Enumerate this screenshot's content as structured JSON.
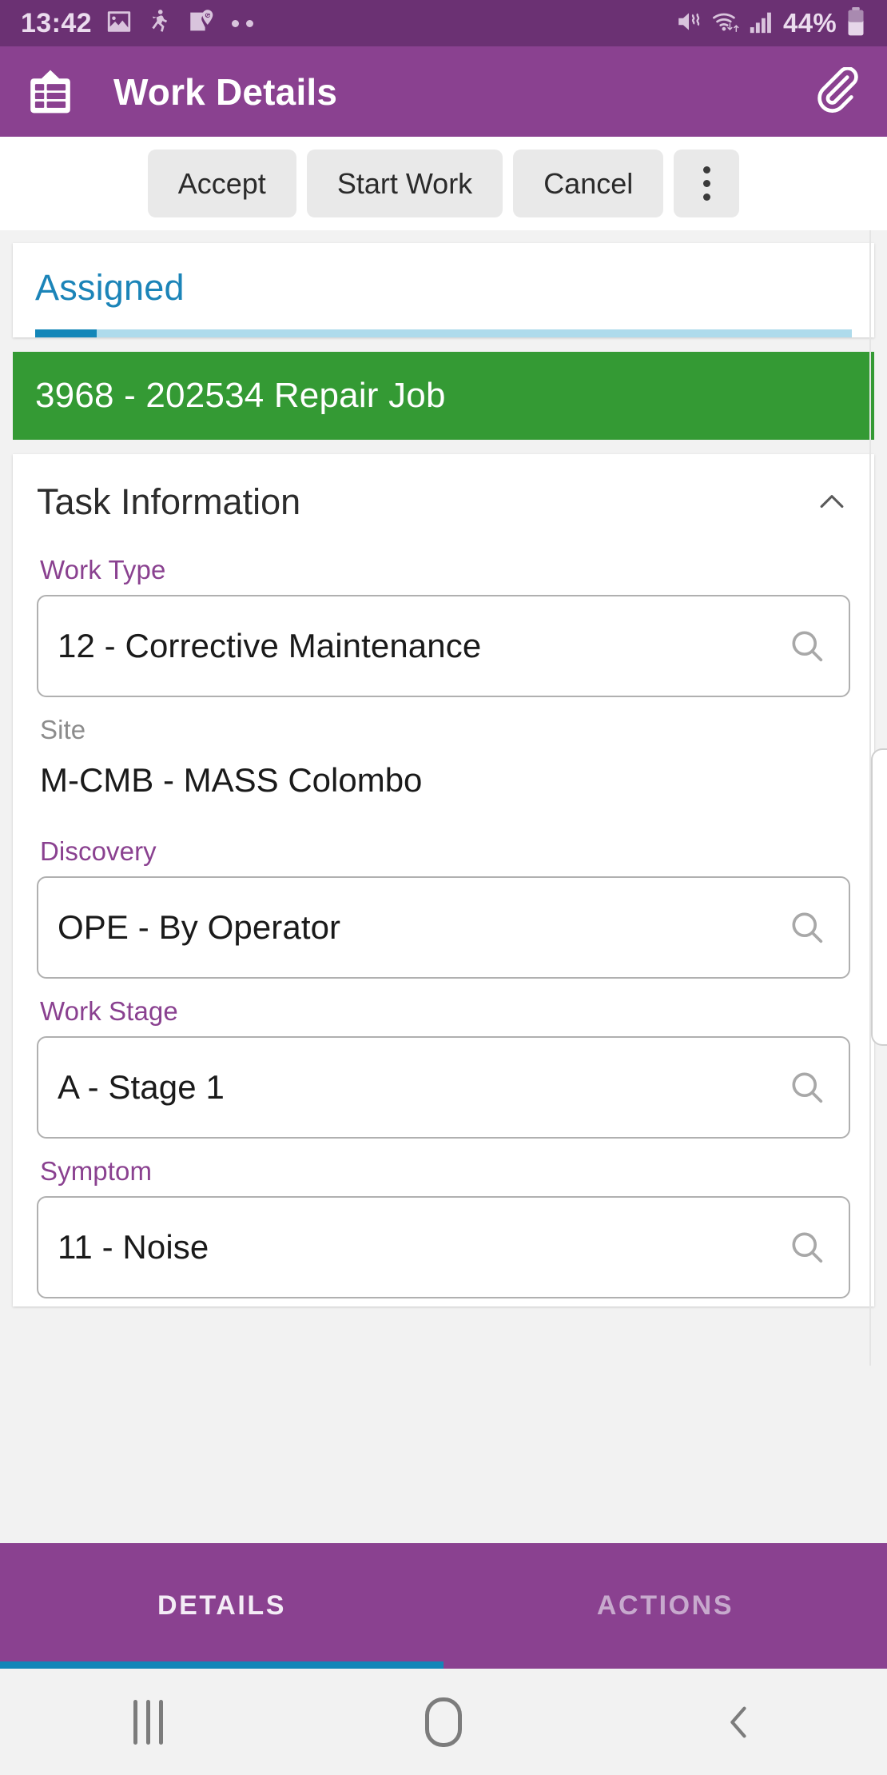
{
  "status_bar": {
    "time": "13:42",
    "battery_percent": "44%",
    "icons": [
      "image-icon",
      "running-person-icon",
      "google-maps-icon",
      "more-notifications-dots",
      "vibrate-icon",
      "wifi-icon",
      "cell-signal-icon",
      "battery-icon"
    ]
  },
  "app_bar": {
    "title": "Work Details",
    "logo_icon": "clipboard-list-icon",
    "attach_icon": "paperclip-icon"
  },
  "action_bar": {
    "buttons": [
      {
        "label": "Accept",
        "name": "accept-button"
      },
      {
        "label": "Start Work",
        "name": "start-work-button"
      },
      {
        "label": "Cancel",
        "name": "cancel-button"
      }
    ],
    "overflow_icon": "more-vertical-icon"
  },
  "status_card": {
    "label": "Assigned",
    "progress_percent": 7.5,
    "accent_color": "#1386B8"
  },
  "job_banner": {
    "text": "3968 - 202534 Repair Job",
    "color": "#349A34"
  },
  "section": {
    "title": "Task Information",
    "collapse_icon": "chevron-up-icon",
    "fields": [
      {
        "label": "Work Type",
        "value": "12 - Corrective Maintenance",
        "type": "lookup",
        "readonly": false,
        "icon": "search-icon",
        "name": "work-type"
      },
      {
        "label": "Site",
        "value": "M-CMB - MASS Colombo",
        "type": "text",
        "readonly": true,
        "name": "site"
      },
      {
        "label": "Discovery",
        "value": "OPE - By Operator",
        "type": "lookup",
        "readonly": false,
        "icon": "search-icon",
        "name": "discovery"
      },
      {
        "label": "Work Stage",
        "value": "A - Stage 1",
        "type": "lookup",
        "readonly": false,
        "icon": "search-icon",
        "name": "work-stage"
      },
      {
        "label": "Symptom",
        "value": "11 - Noise",
        "type": "lookup",
        "readonly": false,
        "icon": "search-icon",
        "name": "symptom"
      }
    ]
  },
  "tabs": [
    {
      "label": "DETAILS",
      "active": true,
      "name": "tab-details"
    },
    {
      "label": "ACTIONS",
      "active": false,
      "name": "tab-actions"
    }
  ],
  "nav_bar": {
    "recents_icon": "recents-icon",
    "home_icon": "home-icon",
    "back_icon": "back-icon"
  },
  "theme": {
    "status_bar_bg": "#6B3173",
    "app_bar_bg": "#8A4190",
    "label_purple": "#8A4190",
    "accent_blue": "#1386B8",
    "banner_green": "#349A34"
  }
}
